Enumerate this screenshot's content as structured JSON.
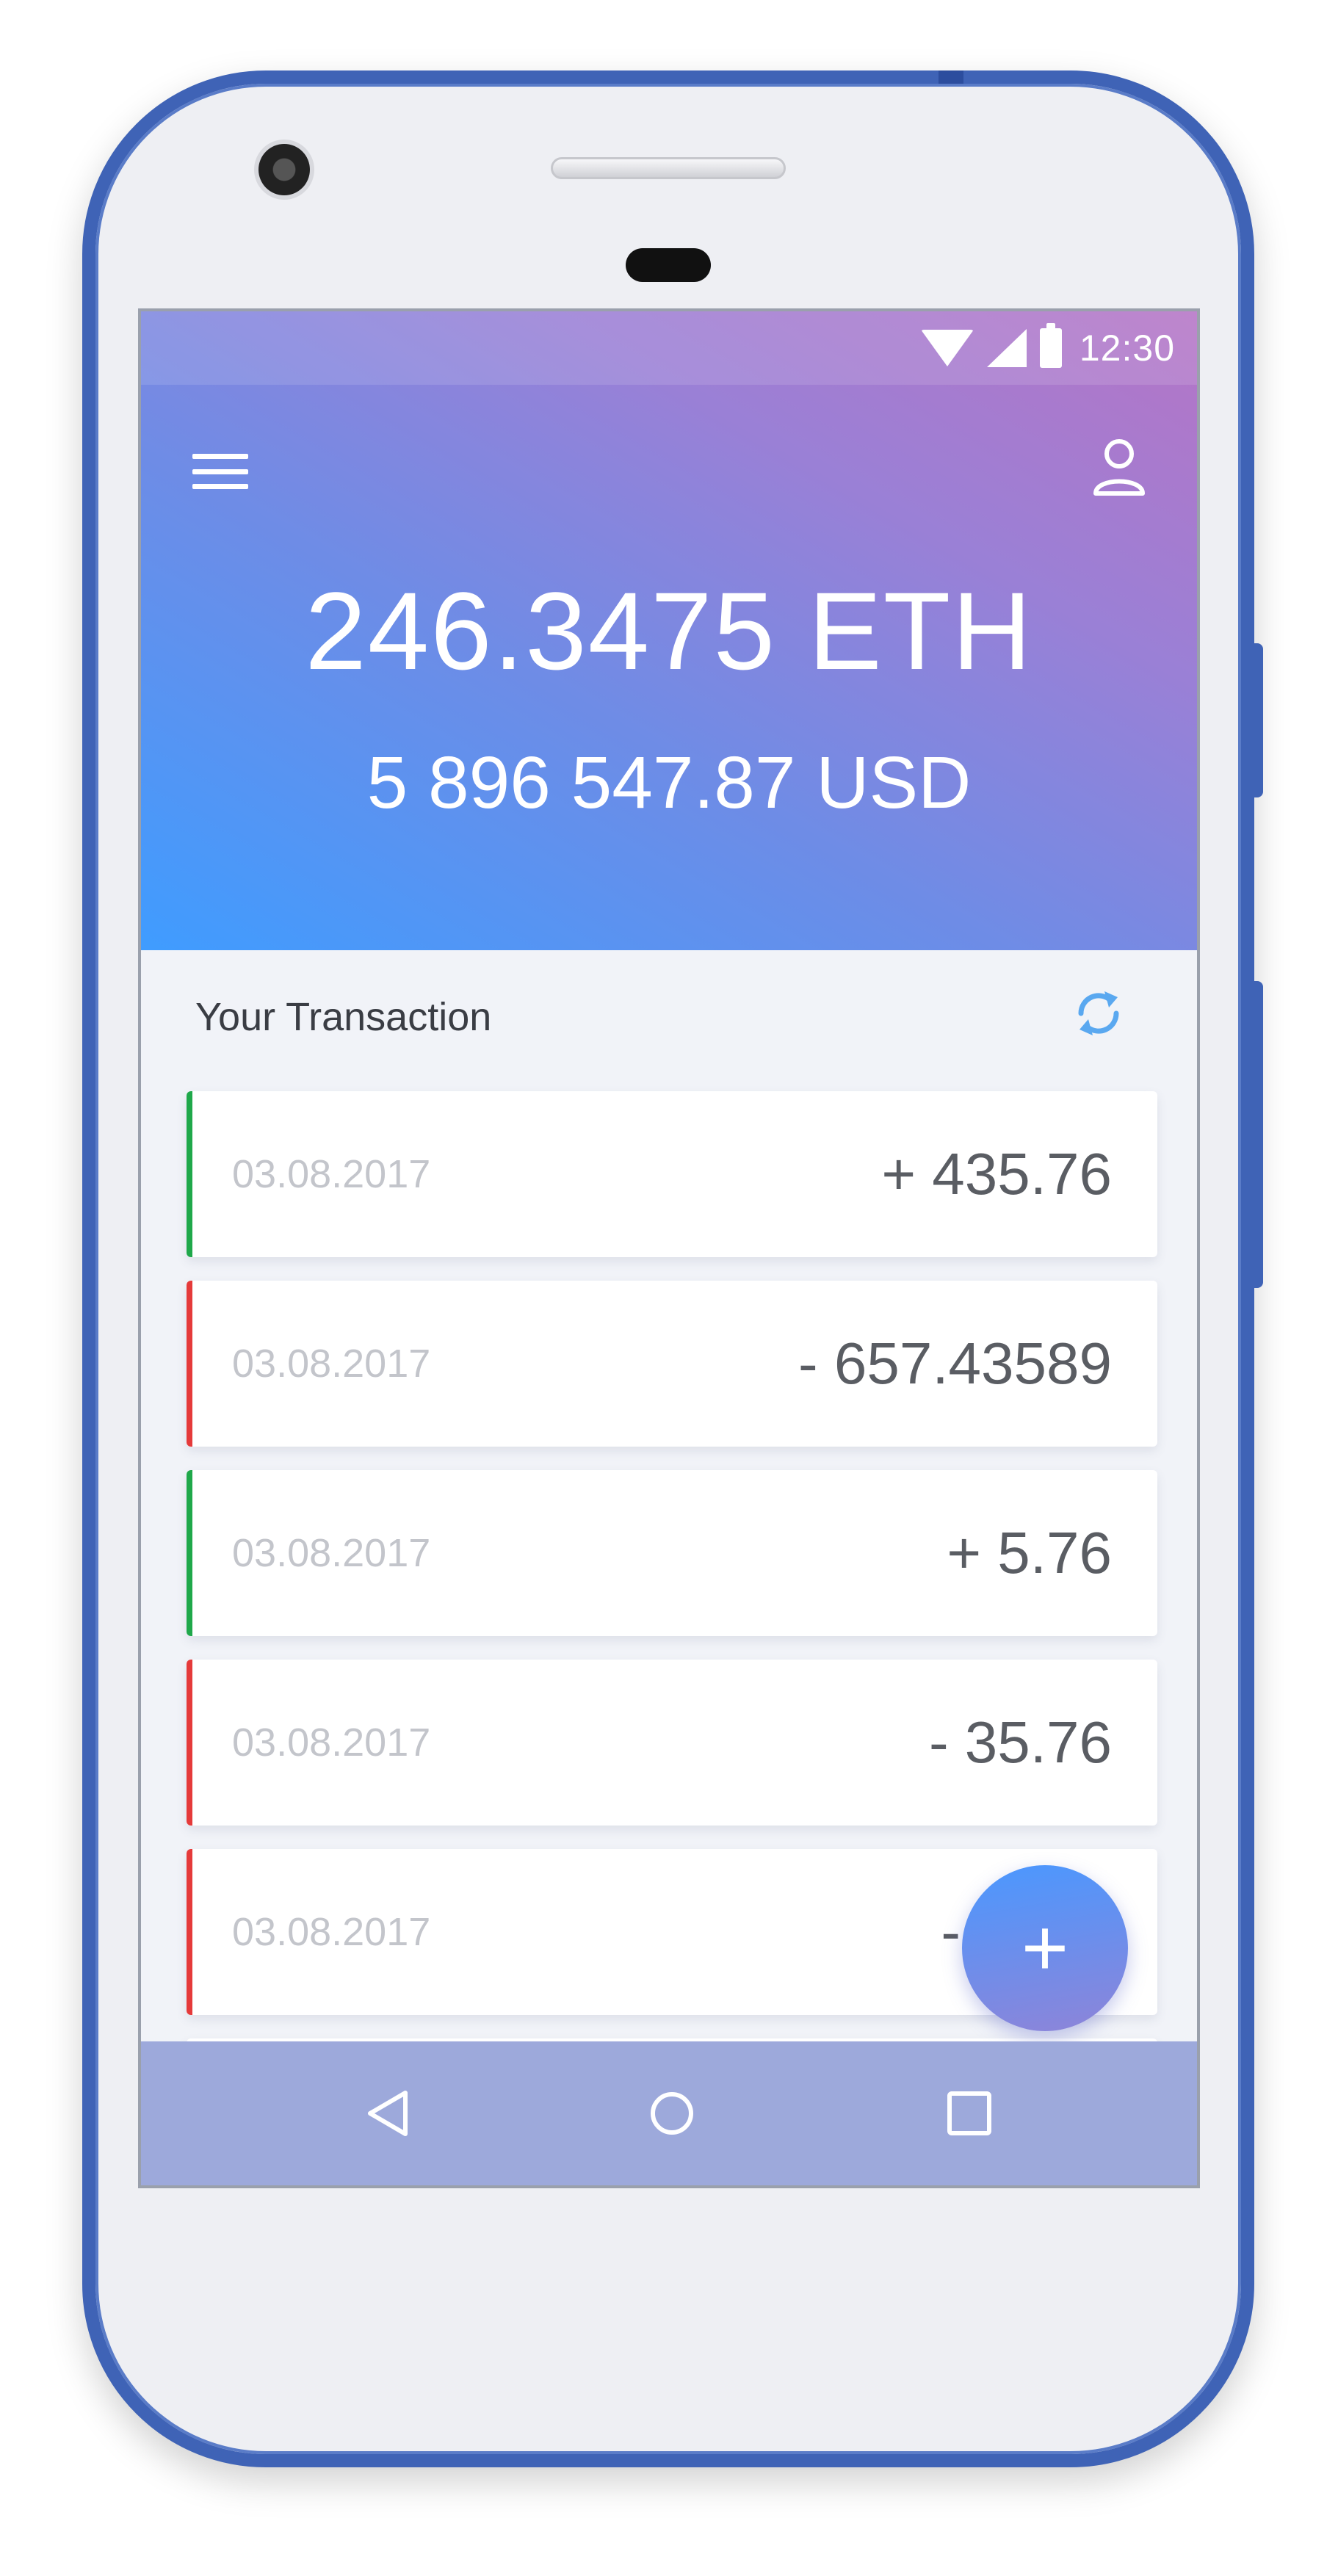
{
  "status_bar": {
    "time": "12:30"
  },
  "header": {
    "menu_icon": "hamburger-menu-icon",
    "profile_icon": "user-profile-icon",
    "balance_eth": "246.3475 ETH",
    "balance_usd": "5 896 547.87 USD"
  },
  "transactions": {
    "heading": "Your Transaction",
    "refresh_icon": "refresh-icon",
    "items": [
      {
        "date": "03.08.2017",
        "amount": "+ 435.76",
        "type": "credit"
      },
      {
        "date": "03.08.2017",
        "amount": "- 657.43589",
        "type": "debit"
      },
      {
        "date": "03.08.2017",
        "amount": "+ 5.76",
        "type": "credit"
      },
      {
        "date": "03.08.2017",
        "amount": "- 35.76",
        "type": "debit"
      },
      {
        "date": "03.08.2017",
        "amount": "-",
        "type": "debit"
      }
    ]
  },
  "fab": {
    "label": "+"
  },
  "colors": {
    "credit": "#1fa84a",
    "debit": "#e53a3a",
    "accent": "#4a98ff"
  }
}
